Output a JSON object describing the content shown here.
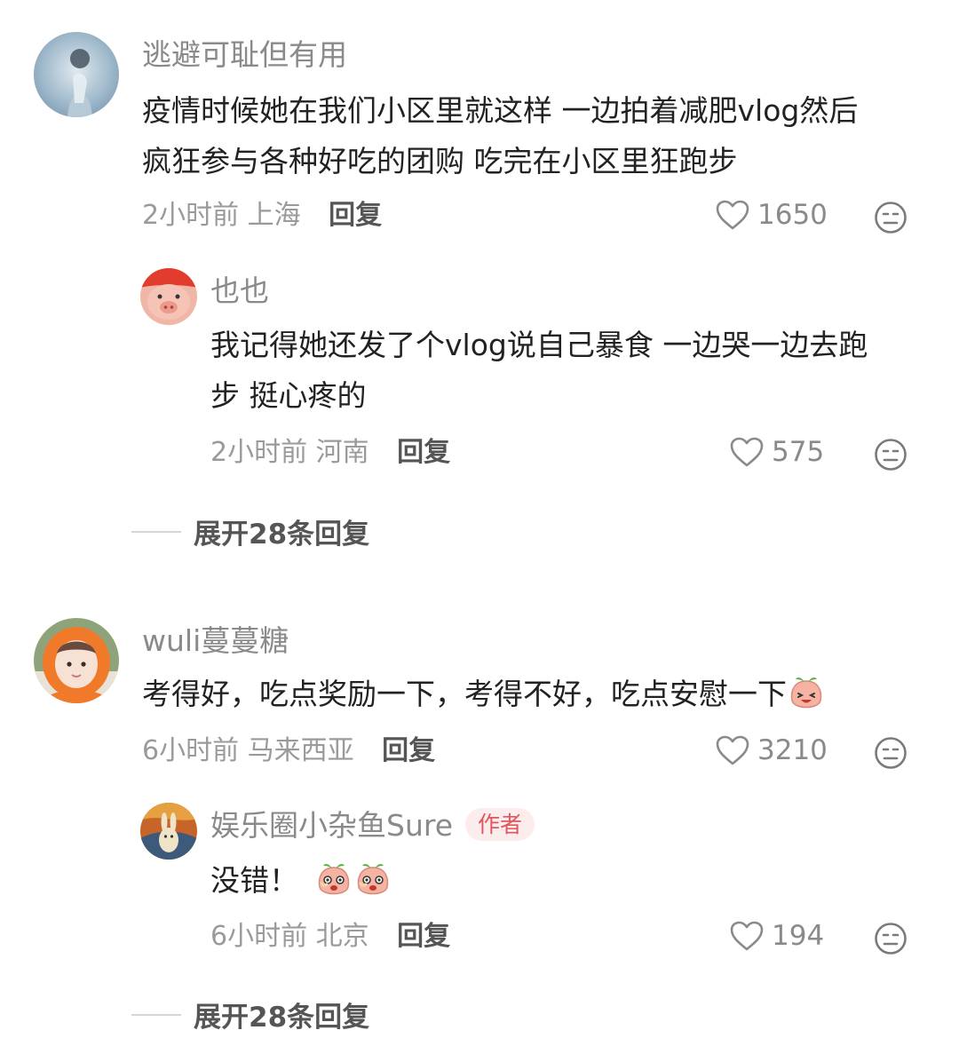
{
  "comments": [
    {
      "username": "逃避可耻但有用",
      "text_lines": [
        "疫情时候她在我们小区里就这样 一边拍着减肥vlog然后",
        "疯狂参与各种好吃的团购 吃完在小区里狂跑步"
      ],
      "time_location": "2小时前 上海",
      "reply_label": "回复",
      "likes": "1650",
      "reply": {
        "username": "也也",
        "text_lines": [
          "我记得她还发了个vlog说自己暴食 一边哭一边去跑",
          "步 挺心疼的"
        ],
        "time_location": "2小时前 河南",
        "reply_label": "回复",
        "likes": "575"
      },
      "expand_label": "展开28条回复"
    },
    {
      "username": "wuli蔓蔓糖",
      "text_lines": [
        "考得好，吃点奖励一下，考得不好，吃点安慰一下"
      ],
      "time_location": "6小时前 马来西亚",
      "reply_label": "回复",
      "likes": "3210",
      "reply": {
        "username": "娱乐圈小杂鱼Sure",
        "badge": "作者",
        "text_lines": [
          "没错！"
        ],
        "time_location": "6小时前 北京",
        "reply_label": "回复",
        "likes": "194"
      },
      "expand_label": "展开28条回复"
    }
  ],
  "colors": {
    "username": "#8a8a8a",
    "text": "#222222",
    "meta": "#9a9a9a",
    "badge_bg": "#fdecec",
    "badge_text": "#e0555f"
  },
  "icons": {
    "like": "heart-outline-icon",
    "dislike": "neutral-face-icon",
    "emoji": "peach-face-emoji"
  }
}
